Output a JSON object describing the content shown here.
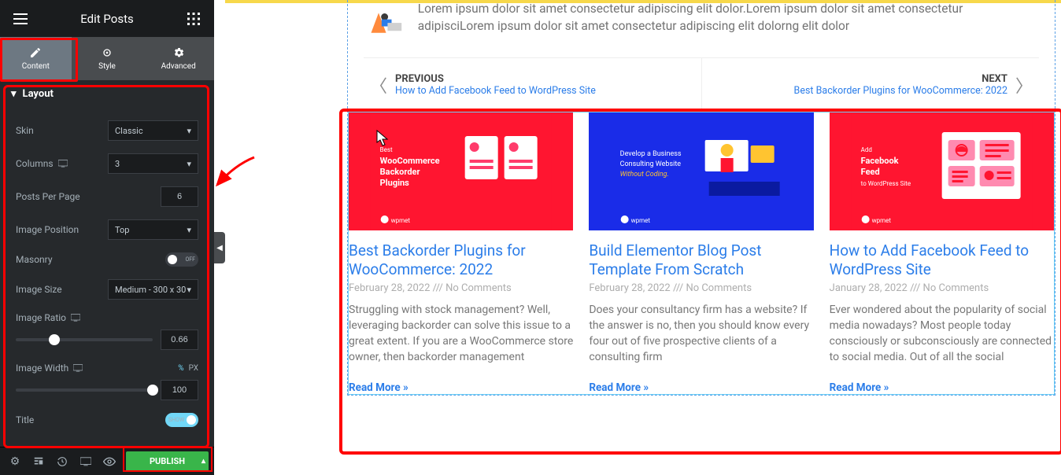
{
  "sidebar": {
    "title": "Edit Posts",
    "tabs": {
      "content": "Content",
      "style": "Style",
      "advanced": "Advanced"
    },
    "layout_label": "Layout",
    "controls": {
      "skin": {
        "label": "Skin",
        "value": "Classic"
      },
      "columns": {
        "label": "Columns",
        "value": "3"
      },
      "posts_per_page": {
        "label": "Posts Per Page",
        "value": "6"
      },
      "image_position": {
        "label": "Image Position",
        "value": "Top"
      },
      "masonry": {
        "label": "Masonry",
        "off_text": "OFF"
      },
      "image_size": {
        "label": "Image Size",
        "value": "Medium - 300 x 30"
      },
      "image_ratio": {
        "label": "Image Ratio",
        "value": "0.66"
      },
      "image_width": {
        "label": "Image Width",
        "value": "100",
        "pct": "%",
        "px": "PX"
      },
      "title": {
        "label": "Title",
        "on_text": "SHOW"
      }
    },
    "publish": "PUBLISH"
  },
  "canvas": {
    "intro": "Lorem ipsum dolor sit amet consectetur adipiscing elit dolor.Lorem ipsum dolor sit amet consectetur adipisciLorem ipsum dolor sit amet consectetur adipiscing elit dolorng elit dolor",
    "prev": {
      "label": "PREVIOUS",
      "link": "How to Add Facebook Feed to WordPress Site"
    },
    "next": {
      "label": "NEXT",
      "link": "Best Backorder Plugins for WooCommerce: 2022"
    },
    "posts": [
      {
        "thumb_title_l1": "WooCommerce",
        "thumb_title_l2": "Backorder",
        "thumb_title_l3": "Plugins",
        "thumb_pre": "Best",
        "title": "Best Backorder Plugins for WooCommerce: 2022",
        "date": "February 28, 2022",
        "comments": "No Comments",
        "excerpt": "Struggling with stock management? Well, leveraging backorder can solve this issue to a great extent. If you are a WooCommerce store owner, then backorder management",
        "read_more": "Read More »"
      },
      {
        "thumb_title_l1": "Develop a Business",
        "thumb_title_l2": "Consulting Website",
        "thumb_title_l3": "Without Coding.",
        "title": "Build Elementor Blog Post Template From Scratch",
        "date": "February 28, 2022",
        "comments": "No Comments",
        "excerpt": "Does your consultancy firm has a website?  If the answer is no, then you should know every four out of five prospective clients of a consulting firm",
        "read_more": "Read More »"
      },
      {
        "thumb_title_l1": "Facebook",
        "thumb_title_l2": "Feed",
        "thumb_title_l3": "to WordPress Site",
        "thumb_pre": "Add",
        "title": "How to Add Facebook Feed to WordPress Site",
        "date": "January 28, 2022",
        "comments": "No Comments",
        "excerpt": "Ever wondered about the popularity of social media nowadays? Most people today consciously or subconsciously are connected to social media. Out of all the social",
        "read_more": "Read More »"
      }
    ]
  }
}
